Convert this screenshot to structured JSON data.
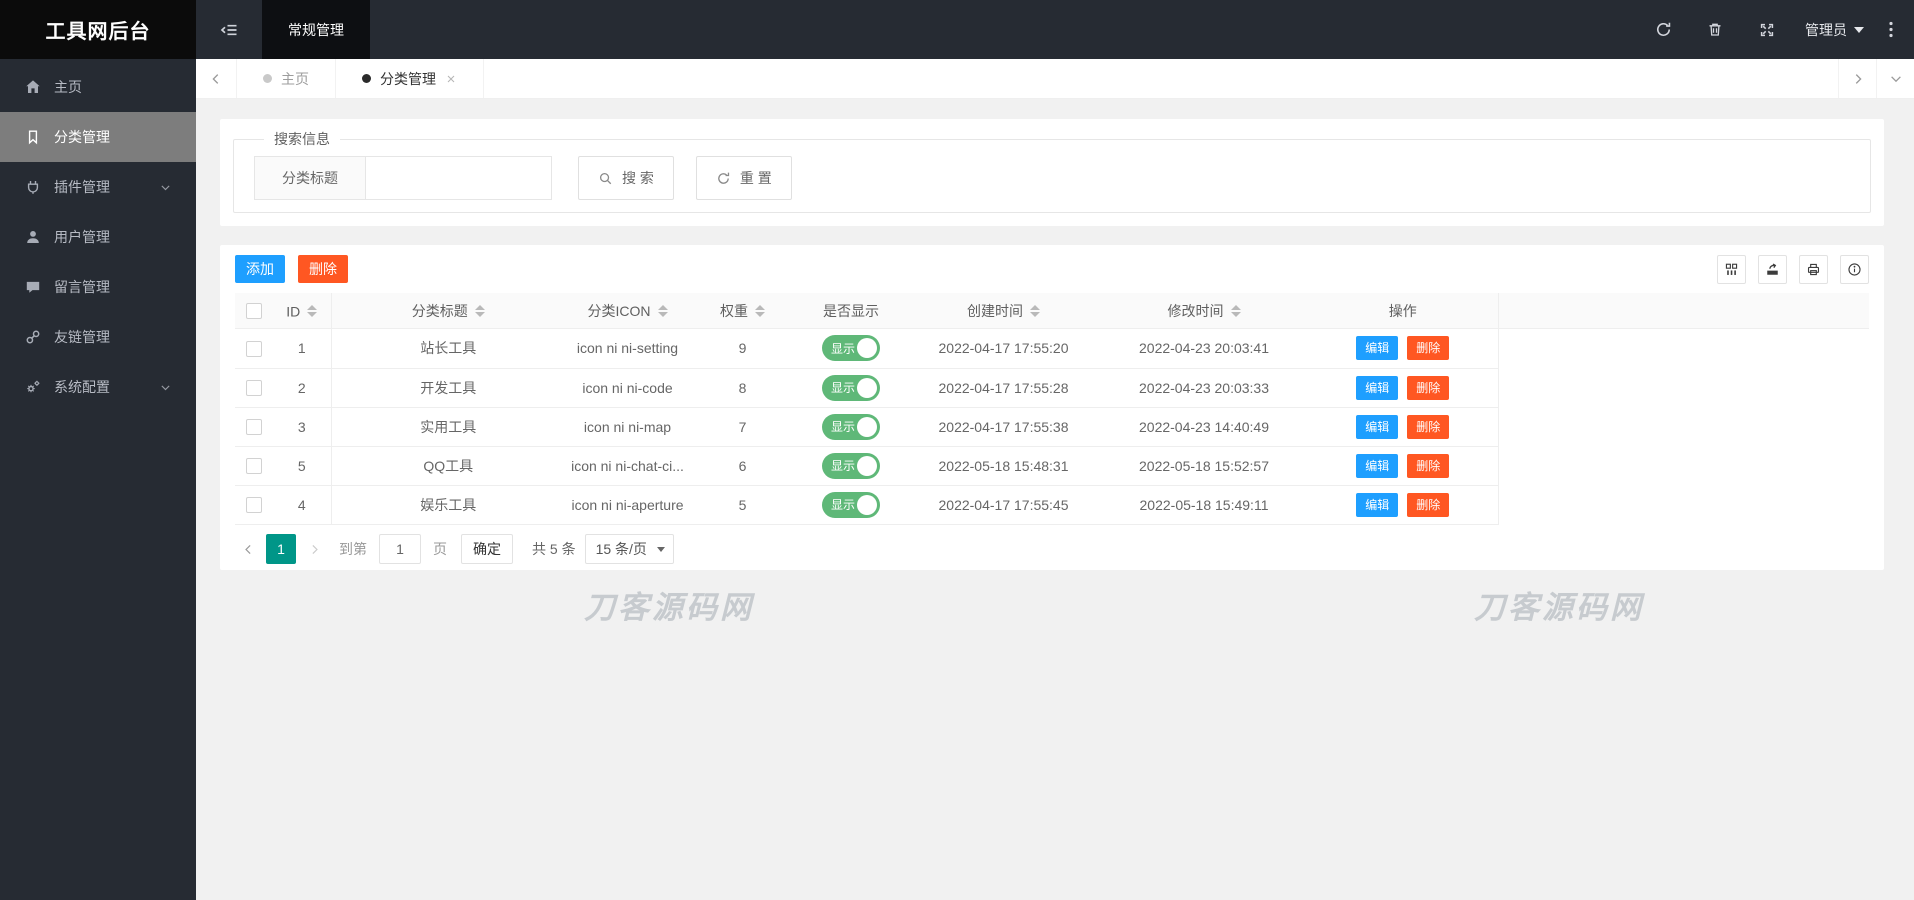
{
  "header": {
    "logo": "工具网后台",
    "nav_tab": "常规管理",
    "admin_label": "管理员"
  },
  "tabbar": {
    "tabs": [
      {
        "label": "主页"
      },
      {
        "label": "分类管理"
      }
    ]
  },
  "sidebar": {
    "items": [
      {
        "label": "主页"
      },
      {
        "label": "分类管理"
      },
      {
        "label": "插件管理"
      },
      {
        "label": "用户管理"
      },
      {
        "label": "留言管理"
      },
      {
        "label": "友链管理"
      },
      {
        "label": "系统配置"
      }
    ]
  },
  "search": {
    "legend": "搜索信息",
    "field_label": "分类标题",
    "input_value": "",
    "search_label": "搜 索",
    "reset_label": "重 置"
  },
  "toolbar": {
    "add_label": "添加",
    "delete_label": "删除"
  },
  "table": {
    "columns": [
      {
        "label": "ID"
      },
      {
        "label": "分类标题"
      },
      {
        "label": "分类ICON"
      },
      {
        "label": "权重"
      },
      {
        "label": "是否显示"
      },
      {
        "label": "创建时间"
      },
      {
        "label": "修改时间"
      },
      {
        "label": "操作"
      }
    ],
    "switch_on_label": "显示",
    "edit_label": "编辑",
    "delete_label": "删除",
    "rows": [
      {
        "id": "1",
        "title": "站长工具",
        "icon": "icon ni ni-setting",
        "weight": "9",
        "created": "2022-04-17 17:55:20",
        "modified": "2022-04-23 20:03:41"
      },
      {
        "id": "2",
        "title": "开发工具",
        "icon": "icon ni ni-code",
        "weight": "8",
        "created": "2022-04-17 17:55:28",
        "modified": "2022-04-23 20:03:33"
      },
      {
        "id": "3",
        "title": "实用工具",
        "icon": "icon ni ni-map",
        "weight": "7",
        "created": "2022-04-17 17:55:38",
        "modified": "2022-04-23 14:40:49"
      },
      {
        "id": "5",
        "title": "QQ工具",
        "icon": "icon ni ni-chat-ci...",
        "weight": "6",
        "created": "2022-05-18 15:48:31",
        "modified": "2022-05-18 15:52:57"
      },
      {
        "id": "4",
        "title": "娱乐工具",
        "icon": "icon ni ni-aperture",
        "weight": "5",
        "created": "2022-04-17 17:55:45",
        "modified": "2022-05-18 15:49:11"
      }
    ]
  },
  "pagination": {
    "current_page": "1",
    "goto_prefix": "到第",
    "goto_value": "1",
    "goto_suffix": "页",
    "confirm_label": "确定",
    "total_label": "共 5 条",
    "page_size_label": "15 条/页"
  },
  "watermark": {
    "text": "刀客源码网"
  },
  "colors": {
    "primary_blue": "#1E9FFF",
    "danger_orange": "#FF5722",
    "switch_green": "#5FB878",
    "pager_teal": "#009688",
    "dark_bar": "#262b33",
    "active_sidebar_gray": "#7d7d7d"
  }
}
